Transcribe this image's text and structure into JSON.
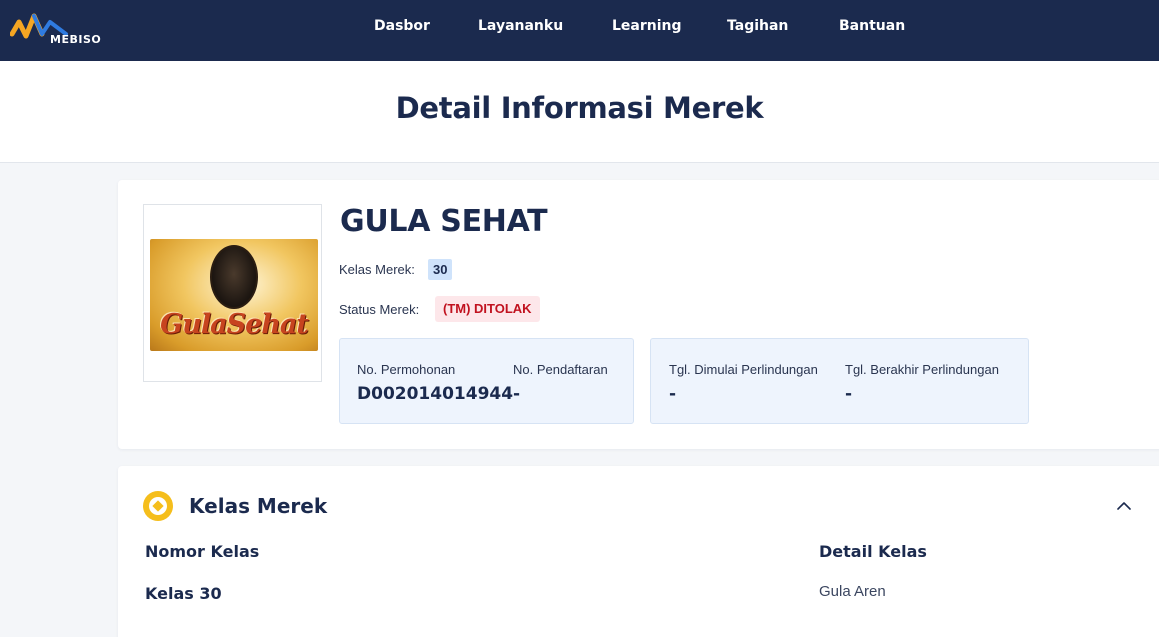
{
  "brand": {
    "logo_text": "MEBISO",
    "logo_icon": "mebiso-wave-logo-icon"
  },
  "nav": {
    "items": [
      {
        "label": "Dasbor"
      },
      {
        "label": "Layananku"
      },
      {
        "label": "Learning"
      },
      {
        "label": "Tagihan"
      },
      {
        "label": "Bantuan"
      }
    ]
  },
  "page": {
    "title": "Detail Informasi Merek"
  },
  "merek": {
    "name": "GULA SEHAT",
    "image_script_text": "GulaSehat",
    "kelas_label": "Kelas Merek:",
    "kelas_value": "30",
    "status_label": "Status Merek:",
    "status_value": "(TM) DITOLAK",
    "no_permohonan_label": "No. Permohonan",
    "no_permohonan_value": "D002014014944",
    "no_pendaftaran_label": "No. Pendaftaran",
    "no_pendaftaran_value": "-",
    "tgl_mulai_label": "Tgl. Dimulai Perlindungan",
    "tgl_mulai_value": "-",
    "tgl_berakhir_label": "Tgl. Berakhir Perlindungan",
    "tgl_berakhir_value": "-"
  },
  "kelas_section": {
    "title": "Kelas Merek",
    "icon": "coin-icon",
    "col_nomor": "Nomor Kelas",
    "col_detail": "Detail Kelas",
    "rows": [
      {
        "nomor": "Kelas 30",
        "detail": "Gula Aren"
      }
    ]
  },
  "colors": {
    "navbar": "#1b2a4e",
    "accent_yellow": "#f5be1c",
    "status_red": "#c1121f",
    "badge_blue": "#cfe3fb"
  }
}
